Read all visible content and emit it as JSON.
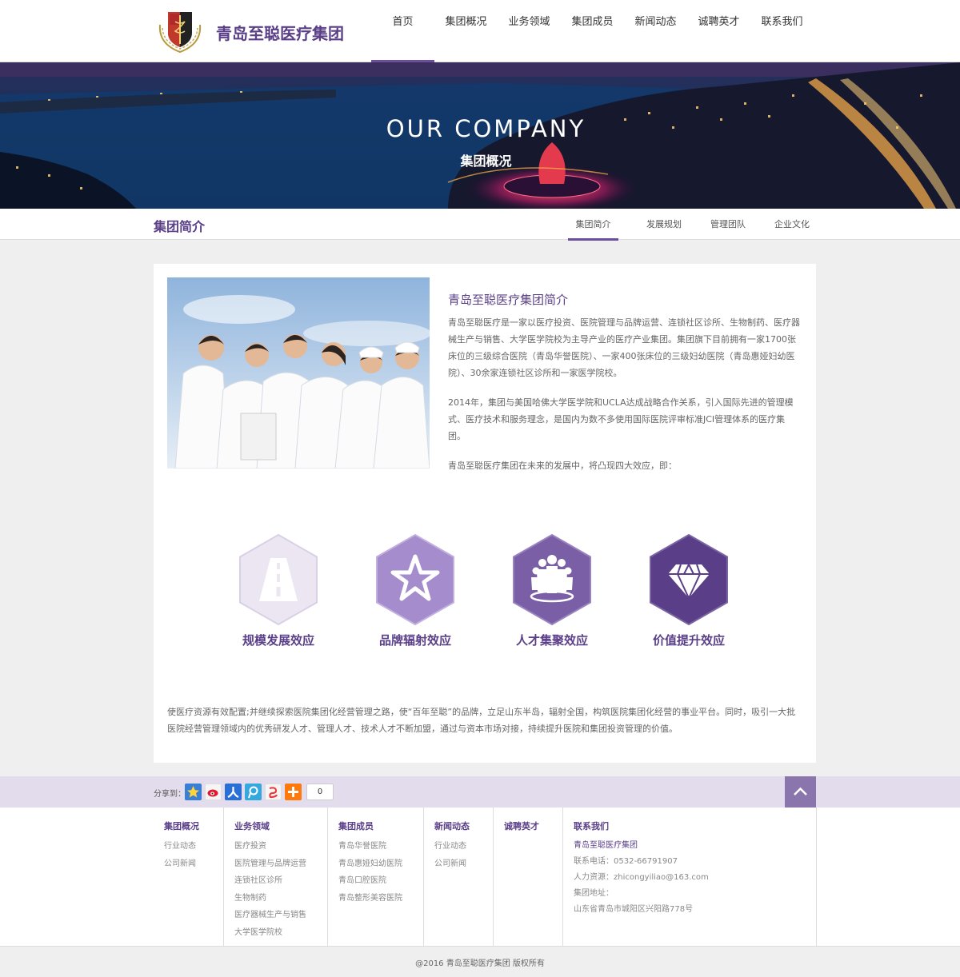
{
  "header": {
    "logo_text": "青岛至聪医疗集团",
    "nav": [
      "首页",
      "集团概况",
      "业务领域",
      "集团成员",
      "新闻动态",
      "诚聘英才",
      "联系我们"
    ]
  },
  "banner": {
    "title": "OUR COMPANY",
    "subtitle": "集团概况"
  },
  "subnav": {
    "title": "集团简介",
    "tabs": [
      "集团简介",
      "发展规划",
      "管理团队",
      "企业文化"
    ]
  },
  "intro": {
    "title": "青岛至聪医疗集团简介",
    "paragraphs": [
      "青岛至聪医疗是一家以医疗投资、医院管理与品牌运营、连锁社区诊所、生物制药、医疗器械生产与销售、大学医学院校为主导产业的医疗产业集团。集团旗下目前拥有一家1700张床位的三级综合医院（青岛华誉医院）、一家400张床位的三级妇幼医院（青岛惠娅妇幼医院）、30余家连锁社区诊所和一家医学院校。",
      "2014年，集团与美国哈佛大学医学院和UCLA达成战略合作关系，引入国际先进的管理模式、医疗技术和服务理念，是国内为数不多使用国际医院评审标准JCI管理体系的医疗集团。",
      "青岛至聪医疗集团在未来的发展中，将凸现四大效应，即："
    ]
  },
  "features": [
    {
      "label": "规模发展效应",
      "icon": "road-icon",
      "color": "#e8e3f0"
    },
    {
      "label": "品牌辐射效应",
      "icon": "star-icon",
      "color": "#a58ccd"
    },
    {
      "label": "人才集聚效应",
      "icon": "people-icon",
      "color": "#7a5fa6"
    },
    {
      "label": "价值提升效应",
      "icon": "diamond-icon",
      "color": "#5a3f88"
    }
  ],
  "summary": "使医疗资源有效配置;并继续探索医院集团化经营管理之路，使“百年至聪”的品牌，立足山东半岛，辐射全国，构筑医院集团化经营的事业平台。同时，吸引一大批医院经营管理领域内的优秀研发人才、管理人才、技术人才不断加盟，通过与资本市场对接，持续提升医院和集团投资管理的价值。",
  "share": {
    "label": "分享到：",
    "count": "0"
  },
  "footer": {
    "columns": [
      {
        "title": "集团概况",
        "links": [
          "行业动态",
          "公司新闻"
        ]
      },
      {
        "title": "业务领域",
        "links": [
          "医疗投资",
          "医院管理与品牌运营",
          "连锁社区诊所",
          "生物制药",
          "医疗器械生产与销售",
          "大学医学院校"
        ]
      },
      {
        "title": "集团成员",
        "links": [
          "青岛华誉医院",
          "青岛惠娅妇幼医院",
          "青岛口腔医院",
          "青岛整形美容医院"
        ]
      },
      {
        "title": "新闻动态",
        "links": [
          "行业动态",
          "公司新闻"
        ]
      },
      {
        "title": "诚聘英才",
        "links": []
      }
    ],
    "contact": {
      "title": "联系我们",
      "company": "青岛至聪医疗集团",
      "phone": "联系电话：0532-66791907",
      "hr": "人力资源：zhicongyiliao@163.com",
      "address_label": "集团地址：",
      "address": "山东省青岛市城阳区兴阳路778号"
    }
  },
  "copyright": "@2016 青岛至聪医疗集团 版权所有"
}
